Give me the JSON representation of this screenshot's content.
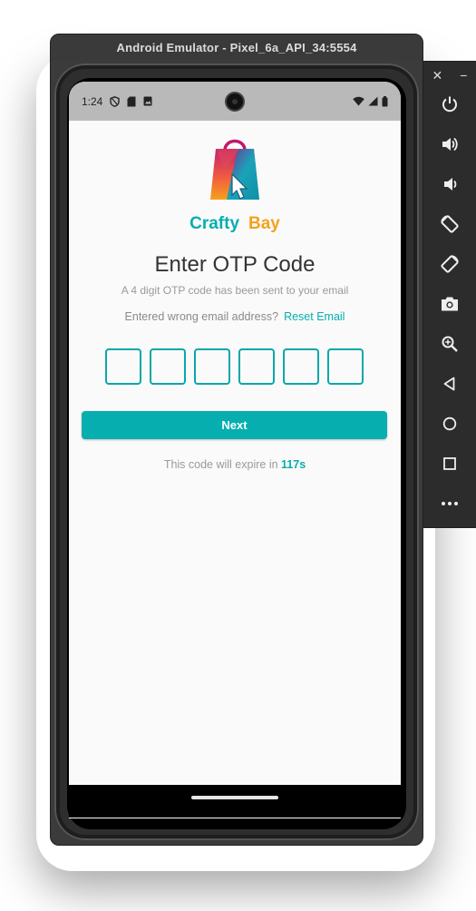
{
  "window": {
    "title": "Android Emulator - Pixel_6a_API_34:5554"
  },
  "status_bar": {
    "time": "1:24",
    "left_icons": [
      "shield-icon",
      "sd-card-icon",
      "image-icon"
    ],
    "right_icons": [
      "wifi-icon",
      "signal-icon",
      "battery-icon"
    ]
  },
  "brand": {
    "word1": "Crafty",
    "word2": "Bay",
    "color1": "#07aeaf",
    "color2": "#f4a21c"
  },
  "screen": {
    "heading": "Enter OTP Code",
    "subtext": "A 4 digit OTP code has been sent to your email",
    "wrong_email_prompt": "Entered wrong email address?",
    "reset_email_link": "Reset Email",
    "otp_fields": [
      "",
      "",
      "",
      "",
      "",
      ""
    ],
    "next_button": "Next",
    "expire_prefix": "This code will expire in",
    "expire_seconds": "117s",
    "accent_color": "#07aeaf"
  },
  "side_panel": {
    "top_controls": [
      "close-icon",
      "minimize-icon"
    ],
    "buttons": [
      "power-icon",
      "volume-up-icon",
      "volume-down-icon",
      "rotate-left-icon",
      "rotate-right-icon",
      "camera-icon",
      "zoom-icon",
      "back-icon",
      "home-icon",
      "overview-icon",
      "more-icon"
    ]
  }
}
